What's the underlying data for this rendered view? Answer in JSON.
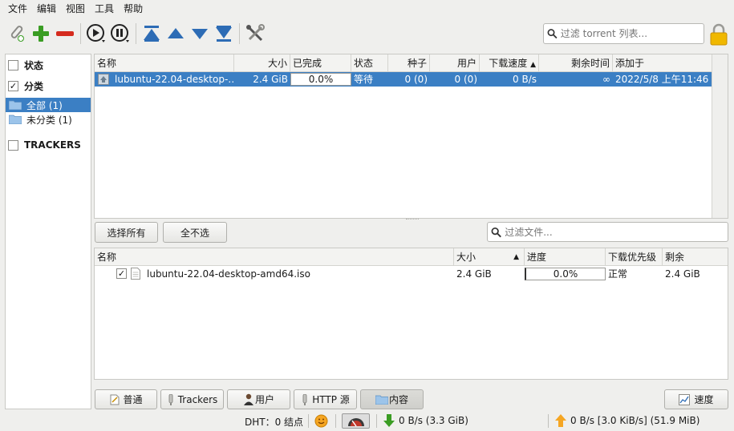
{
  "menu": [
    "文件",
    "编辑",
    "视图",
    "工具",
    "帮助"
  ],
  "search": {
    "torrent_placeholder": "过滤 torrent 列表...",
    "files_placeholder": "过滤文件..."
  },
  "sidebar": {
    "status_label": "状态",
    "category_label": "分类",
    "categories": [
      {
        "label": "全部 (1)",
        "selected": true
      },
      {
        "label": "未分类 (1)",
        "selected": false
      }
    ],
    "trackers_label": "TRACKERS"
  },
  "torrents": {
    "columns": [
      "名称",
      "大小",
      "已完成",
      "状态",
      "种子",
      "用户",
      "下载速度",
      "剩余时间",
      "添加于"
    ],
    "sort_indicator": "▲",
    "rows": [
      {
        "name": "lubuntu-22.04-desktop-…",
        "size": "2.4 GiB",
        "done": "0.0%",
        "status": "等待",
        "seeds": "0 (0)",
        "peers": "0 (0)",
        "down_speed": "0 B/s",
        "eta": "∞",
        "added": "2022/5/8 上午11:46"
      }
    ]
  },
  "buttons": {
    "select_all": "选择所有",
    "select_none": "全不选"
  },
  "files": {
    "columns": [
      "名称",
      "大小",
      "进度",
      "下载优先级",
      "剩余"
    ],
    "sort_indicator": "▲",
    "rows": [
      {
        "checked": true,
        "name": "lubuntu-22.04-desktop-amd64.iso",
        "size": "2.4 GiB",
        "progress": "0.0%",
        "priority": "正常",
        "remaining": "2.4 GiB"
      }
    ]
  },
  "tabs": [
    "普通",
    "Trackers",
    "用户",
    "HTTP 源",
    "内容"
  ],
  "active_tab": "内容",
  "speed_button": "速度",
  "status": {
    "dht": "DHT：0 结点",
    "down": "0 B/s (3.3 GiB)",
    "up": "0 B/s [3.0 KiB/s] (51.9 MiB)"
  },
  "colors": {
    "selection": "#3b7fc4",
    "add_green": "#3a9d23",
    "remove_red": "#d52b1e",
    "nav_blue": "#2d6cb5"
  }
}
